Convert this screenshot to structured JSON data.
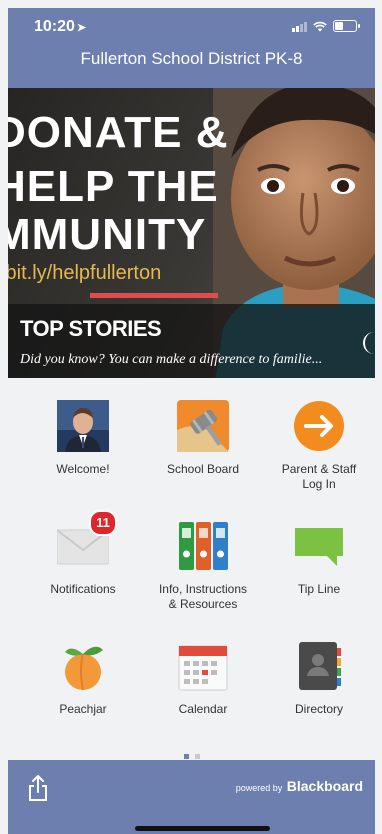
{
  "status_bar": {
    "time": "10:20"
  },
  "header": {
    "title": "Fullerton School District PK-8"
  },
  "hero": {
    "line1": "DONATE &",
    "line2": "HELP THE",
    "line3": "MMUNITY",
    "link": "/bit.ly/helpfullerton",
    "stories_title": "TOP STORIES",
    "stories_subtitle": "Did you know? You can make a difference to familie..."
  },
  "tiles": [
    {
      "label": "Welcome!",
      "icon": "person-photo-icon"
    },
    {
      "label": "School Board",
      "icon": "gavel-icon"
    },
    {
      "label": "Parent & Staff\nLog In",
      "icon": "arrow-circle-icon"
    },
    {
      "label": "Notifications",
      "icon": "envelope-icon",
      "badge": "11"
    },
    {
      "label": "Info, Instructions\n& Resources",
      "icon": "binders-icon"
    },
    {
      "label": "Tip Line",
      "icon": "speech-bubble-icon"
    },
    {
      "label": "Peachjar",
      "icon": "peach-icon"
    },
    {
      "label": "Calendar",
      "icon": "calendar-icon"
    },
    {
      "label": "Directory",
      "icon": "address-book-icon"
    }
  ],
  "footer": {
    "powered_prefix": "powered by",
    "brand": "Blackboard"
  },
  "colors": {
    "header": "#6c7fae",
    "background": "#f1f2f4",
    "accent_orange": "#f28c1e",
    "badge": "#e0262a"
  }
}
